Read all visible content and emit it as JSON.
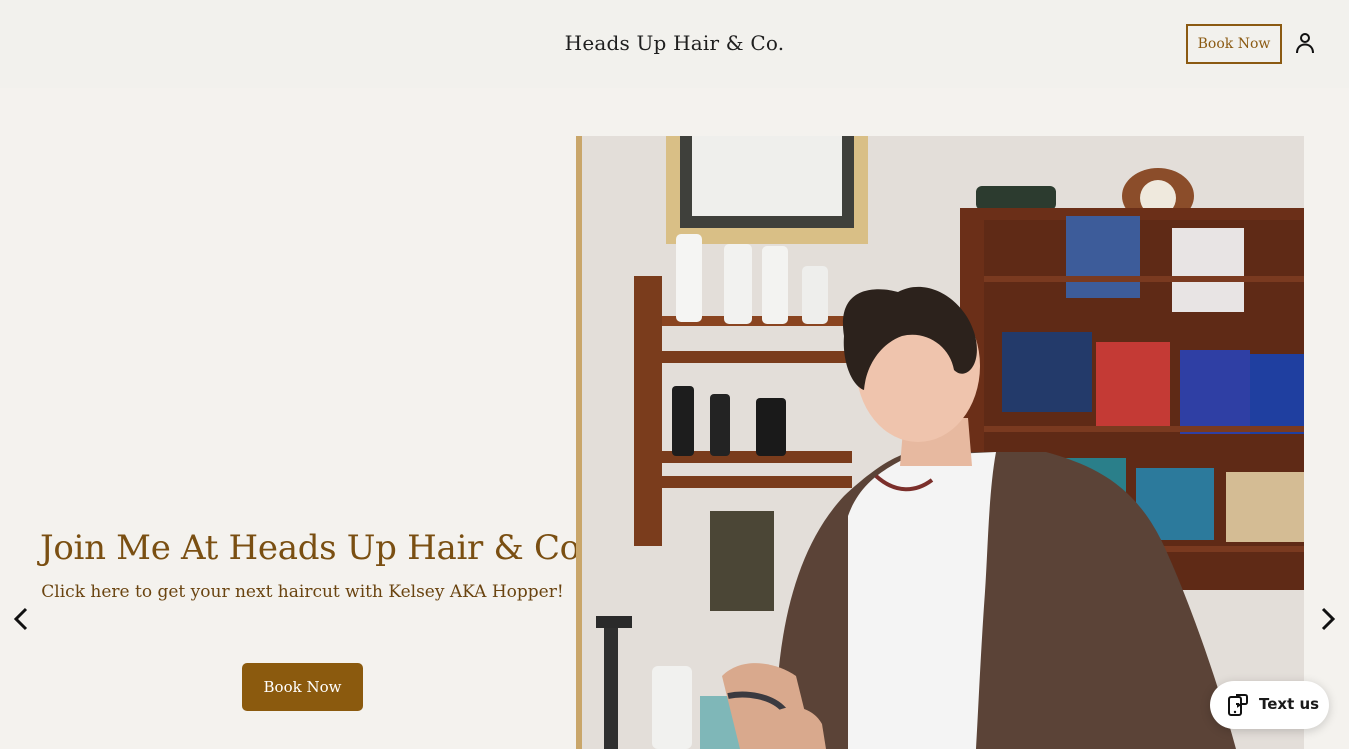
{
  "header": {
    "brand": "Heads Up Hair & Co.",
    "book_label": "Book Now",
    "account_icon": "person-icon"
  },
  "hero": {
    "title": "Join Me At Heads Up Hair & Co.",
    "subtitle": "Click here to get your next haircut with Kelsey AKA Hopper!",
    "book_label": "Book Now",
    "prev_icon": "chevron-left-icon",
    "next_icon": "chevron-right-icon"
  },
  "chat_widget": {
    "label": "Text us",
    "icon": "message-phone-icon"
  },
  "colors": {
    "accent": "#8b5a0e",
    "heading": "#7a4f12",
    "background": "#f4f2ee"
  }
}
